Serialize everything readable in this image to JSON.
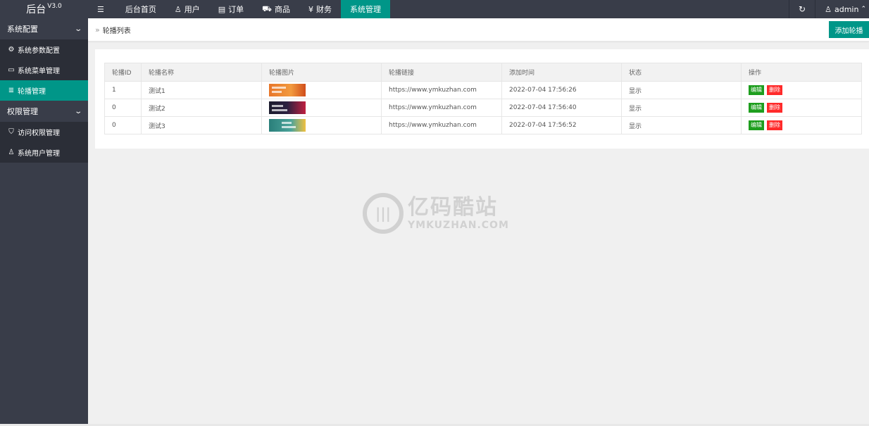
{
  "logo": {
    "title": "后台",
    "version": "V3.0"
  },
  "topnav": {
    "menu_icon": "hamburger-icon",
    "items": [
      {
        "label": "后台首页",
        "icon": ""
      },
      {
        "label": "用户",
        "icon": "user-icon"
      },
      {
        "label": "订单",
        "icon": "document-icon"
      },
      {
        "label": "商品",
        "icon": "cart-icon"
      },
      {
        "label": "财务",
        "icon": "yen-icon"
      },
      {
        "label": "系统管理",
        "icon": "",
        "active": true
      }
    ],
    "refresh_icon": "refresh-icon",
    "user": {
      "name": "admin",
      "icon": "user-icon"
    }
  },
  "sidebar": {
    "groups": [
      {
        "label": "系统配置",
        "items": [
          {
            "label": "系统参数配置",
            "icon": "gear-icon"
          },
          {
            "label": "系统菜单管理",
            "icon": "window-icon"
          },
          {
            "label": "轮播管理",
            "icon": "list-icon",
            "active": true
          }
        ]
      },
      {
        "label": "权限管理",
        "items": [
          {
            "label": "访问权限管理",
            "icon": "shield-icon"
          },
          {
            "label": "系统用户管理",
            "icon": "user-icon"
          }
        ]
      }
    ]
  },
  "breadcrumb": {
    "sep": "»",
    "label": "轮播列表"
  },
  "add_button": "添加轮播",
  "table": {
    "headers": [
      "轮播ID",
      "轮播名称",
      "轮播图片",
      "轮播链接",
      "添加时间",
      "状态",
      "操作"
    ],
    "rows": [
      {
        "id": "1",
        "name": "测试1",
        "link": "https://www.ymkuzhan.com",
        "time": "2022-07-04 17:56:26",
        "status": "显示"
      },
      {
        "id": "0",
        "name": "测试2",
        "link": "https://www.ymkuzhan.com",
        "time": "2022-07-04 17:56:40",
        "status": "显示"
      },
      {
        "id": "0",
        "name": "测试3",
        "link": "https://www.ymkuzhan.com",
        "time": "2022-07-04 17:56:52",
        "status": "显示"
      }
    ],
    "edit_label": "编辑",
    "delete_label": "删除"
  },
  "watermark": {
    "cn": "亿码酷站",
    "en": "YMKUZHAN.COM"
  },
  "colors": {
    "accent": "#009688",
    "dark": "#393D49",
    "edit": "#1e9e1e",
    "delete": "#ff2a2a"
  }
}
